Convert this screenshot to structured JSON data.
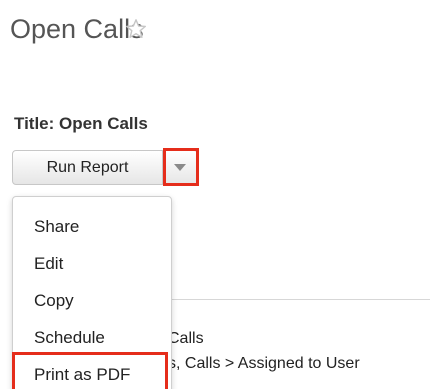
{
  "header": {
    "page_title": "Open Calls",
    "favorite_icon": "star-outline-icon"
  },
  "report": {
    "title": "Title: Open Calls"
  },
  "toolbar": {
    "run_report_label": "Run Report",
    "toggle_icon": "caret-down-icon"
  },
  "menu": {
    "items": [
      {
        "label": "Share"
      },
      {
        "label": "Edit"
      },
      {
        "label": "Copy"
      },
      {
        "label": "Schedule"
      },
      {
        "label": "Print as PDF"
      }
    ]
  },
  "background": {
    "line1": "Calls",
    "line2": "s, Calls > Assigned to User"
  },
  "colors": {
    "highlight": "#e52d1b",
    "title_text": "#555555"
  }
}
